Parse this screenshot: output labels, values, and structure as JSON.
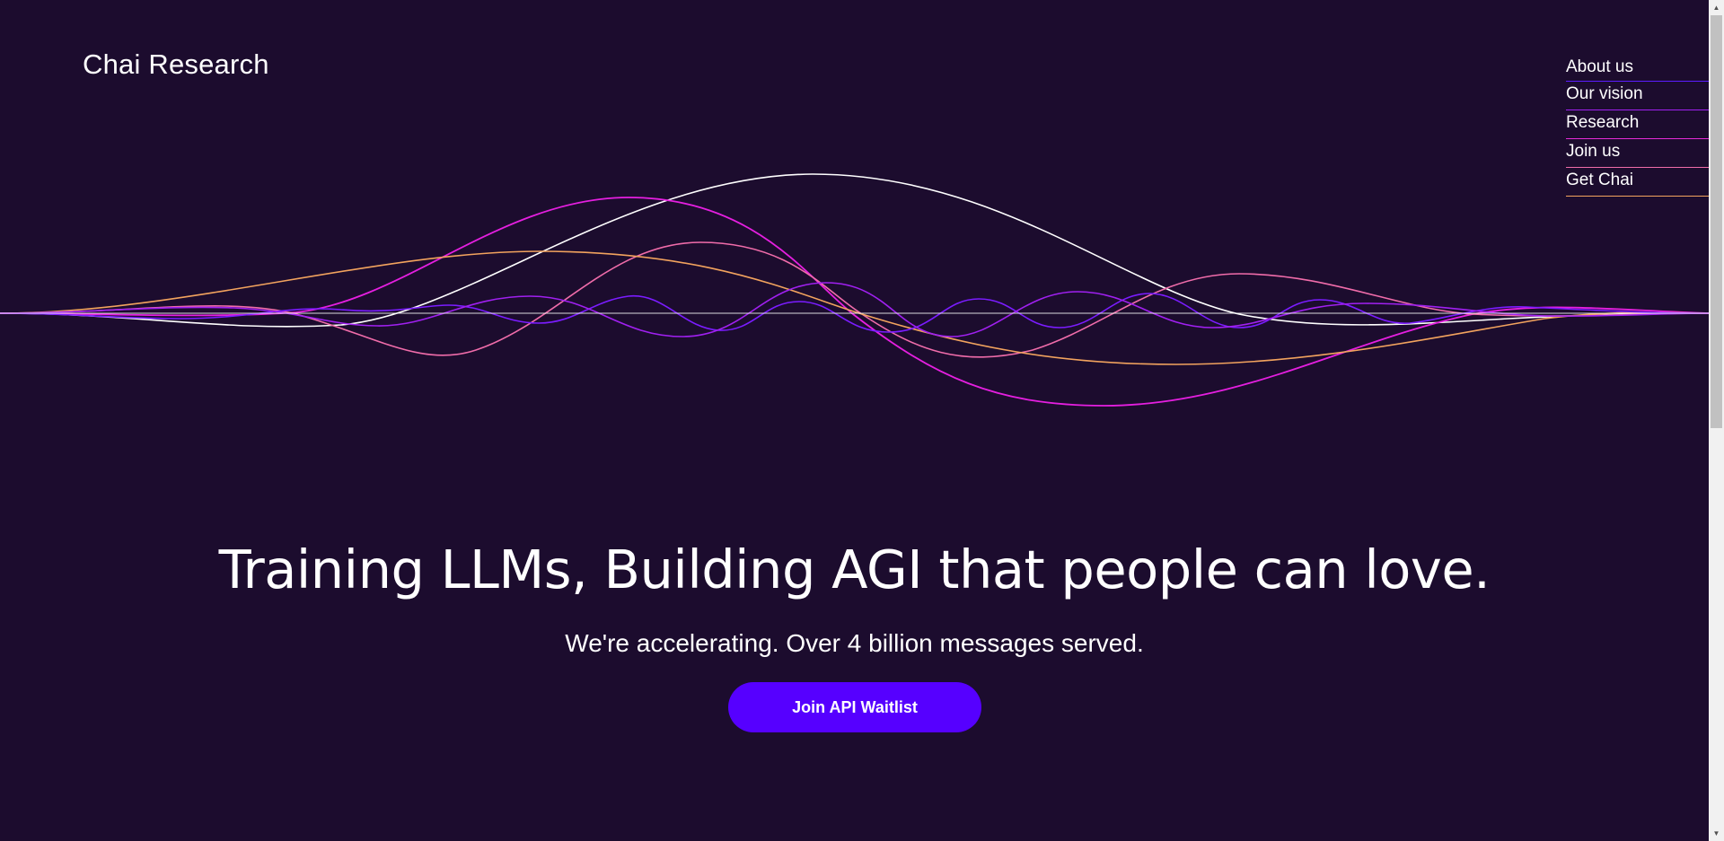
{
  "brand": {
    "name": "Chai Research"
  },
  "nav": {
    "items": [
      {
        "label": "About us"
      },
      {
        "label": "Our vision"
      },
      {
        "label": "Research"
      },
      {
        "label": "Join us"
      },
      {
        "label": "Get Chai"
      }
    ]
  },
  "hero": {
    "headline": "Training LLMs, Building AGI that people can love.",
    "subline": "We're accelerating. Over 4 billion messages served.",
    "cta_label": "Join API Waitlist"
  },
  "colors": {
    "background": "#1c0c2e",
    "accent": "#5600ff",
    "wave_white": "#ffffff",
    "wave_magenta": "#e51fe0",
    "wave_pink": "#f06caa",
    "wave_orange": "#f2a35e",
    "wave_purple": "#7b1cff",
    "wave_violet": "#a020f0"
  },
  "icons": {
    "scroll_up": "triangle-up-icon",
    "scroll_down": "triangle-down-icon"
  }
}
